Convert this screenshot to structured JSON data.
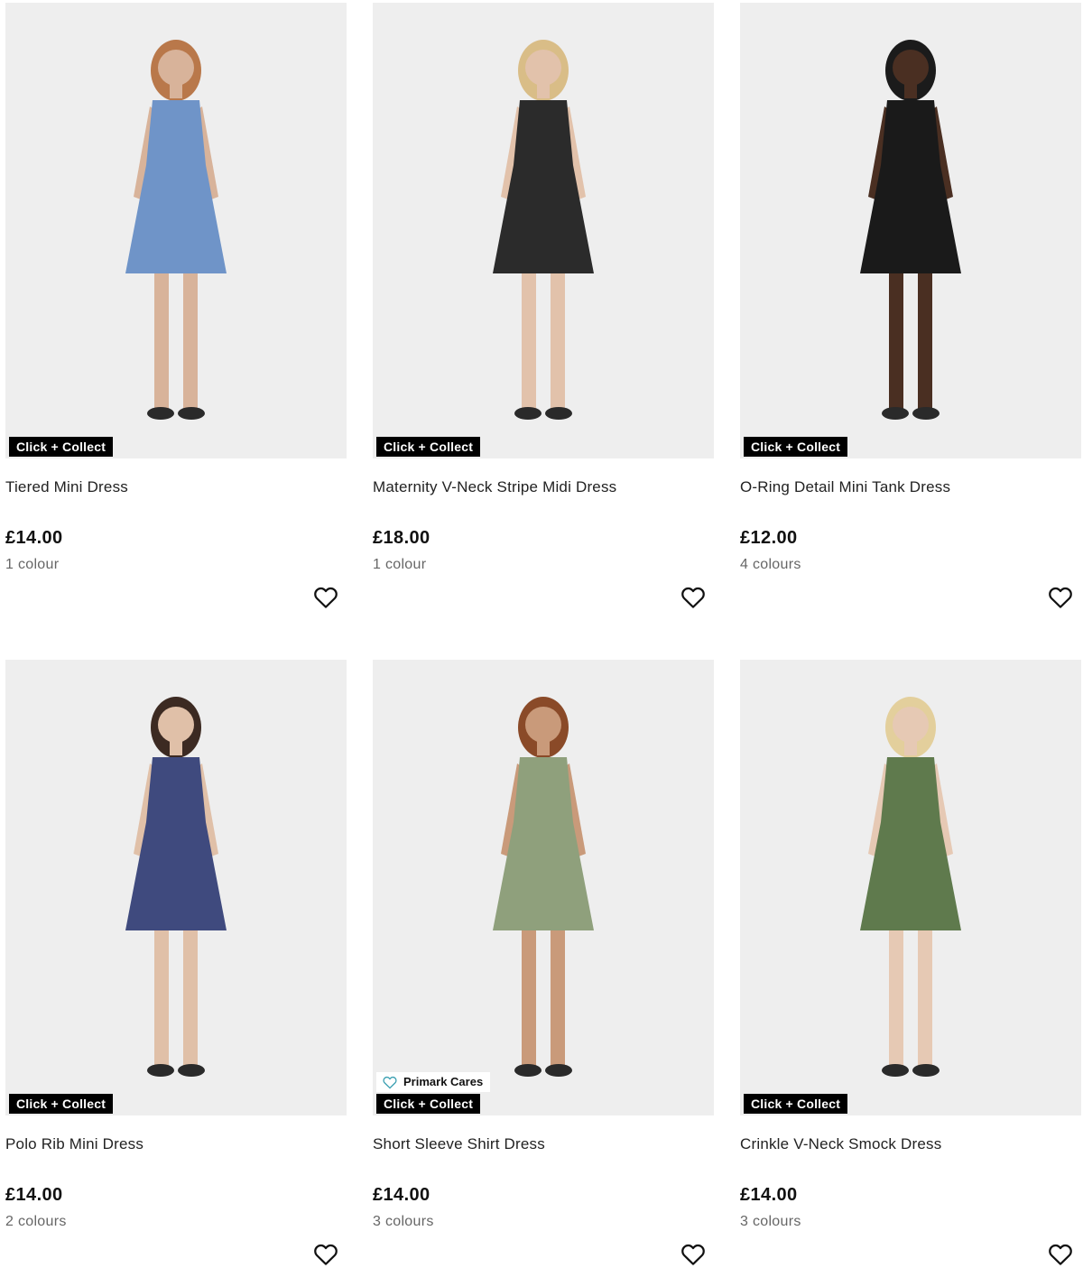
{
  "products": [
    {
      "name": "Tiered Mini Dress",
      "price": "£14.00",
      "colours": "1 colour",
      "badges": {
        "collect": "Click + Collect"
      },
      "dress_color": "#6f94c8",
      "skin_color": "#d8b39a",
      "hair_color": "#b9784a"
    },
    {
      "name": "Maternity V-Neck Stripe Midi Dress",
      "price": "£18.00",
      "colours": "1 colour",
      "badges": {
        "collect": "Click + Collect"
      },
      "dress_color": "#2b2b2b",
      "skin_color": "#e2c2ab",
      "hair_color": "#d9bd87"
    },
    {
      "name": "O-Ring Detail Mini Tank Dress",
      "price": "£12.00",
      "colours": "4 colours",
      "badges": {
        "collect": "Click + Collect"
      },
      "dress_color": "#1a1a1a",
      "skin_color": "#4a2f22",
      "hair_color": "#1b1b1b"
    },
    {
      "name": "Polo Rib Mini Dress",
      "price": "£14.00",
      "colours": "2 colours",
      "badges": {
        "collect": "Click + Collect"
      },
      "dress_color": "#3f4a7e",
      "skin_color": "#e0c0a8",
      "hair_color": "#3c2a22"
    },
    {
      "name": "Short Sleeve Shirt Dress",
      "price": "£14.00",
      "colours": "3 colours",
      "badges": {
        "cares": "Primark Cares",
        "collect": "Click + Collect"
      },
      "dress_color": "#8fa07c",
      "skin_color": "#c99a7a",
      "hair_color": "#8a4a28"
    },
    {
      "name": "Crinkle V-Neck Smock Dress",
      "price": "£14.00",
      "colours": "3 colours",
      "badges": {
        "collect": "Click + Collect"
      },
      "dress_color": "#5f7a4d",
      "skin_color": "#e6c9b4",
      "hair_color": "#e3cf9c"
    }
  ],
  "icons": {
    "wishlist": "heart-outline-icon",
    "cares": "heart-outline-teal-icon"
  },
  "colors": {
    "badge_bg": "#000000",
    "badge_text": "#ffffff",
    "cares_heart": "#3a9fb1",
    "image_bg": "#eeeeee"
  }
}
